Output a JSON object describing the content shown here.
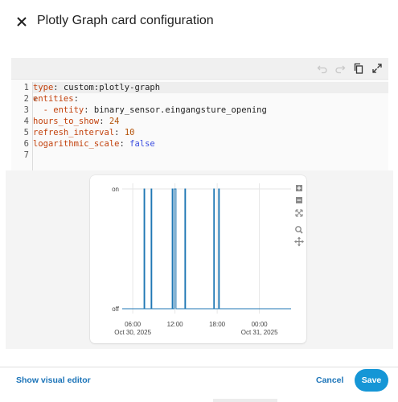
{
  "dialog": {
    "title": "Plotly Graph card configuration",
    "close_icon": "close-icon"
  },
  "toolbar": {
    "icons": [
      "undo-icon",
      "redo-icon",
      "copy-icon",
      "expand-icon"
    ]
  },
  "editor": {
    "line_numbers": [
      "1",
      "2",
      "3",
      "4",
      "5",
      "6",
      "7"
    ],
    "lines": [
      {
        "key": "type",
        "sep": ": ",
        "value": "custom:plotly-graph",
        "value_type": "string"
      },
      {
        "key": "entities",
        "sep": ":",
        "value": "",
        "value_type": "none"
      },
      {
        "key": "  - entity",
        "sep": ": ",
        "value": "binary_sensor.eingangsture_opening",
        "value_type": "string"
      },
      {
        "key": "hours_to_show",
        "sep": ": ",
        "value": "24",
        "value_type": "number"
      },
      {
        "key": "refresh_interval",
        "sep": ": ",
        "value": "10",
        "value_type": "number"
      },
      {
        "key": "logarithmic_scale",
        "sep": ": ",
        "value": "false",
        "value_type": "bool"
      },
      {
        "key": "",
        "sep": "",
        "value": "",
        "value_type": "none"
      }
    ],
    "fold_marker": "v",
    "colors": {
      "key": "#c2410c",
      "number": "#b45309",
      "bool": "#3b4de0"
    }
  },
  "plot": {
    "modebar_icons": [
      "zoom-in-box-icon",
      "zoom-out-box-icon",
      "autoscale-icon",
      "zoom-icon",
      "pan-icon"
    ]
  },
  "chart_data": {
    "type": "line",
    "title": "",
    "xlabel": "",
    "ylabel": "",
    "y_categories": [
      "off",
      "on"
    ],
    "x_tick_labels": [
      {
        "time": "06:00",
        "date": "Oct 30, 2025",
        "hours": 6
      },
      {
        "time": "12:00",
        "date": "",
        "hours": 12
      },
      {
        "time": "18:00",
        "date": "",
        "hours": 18
      },
      {
        "time": "00:00",
        "date": "Oct 31, 2025",
        "hours": 24
      }
    ],
    "xlim_hours": [
      4.5,
      28.5
    ],
    "series": [
      {
        "color": "#1f77b4",
        "on_intervals_hours": [
          [
            7.6,
            7.7
          ],
          [
            8.6,
            8.7
          ],
          [
            11.6,
            11.7
          ],
          [
            11.9,
            12.15
          ],
          [
            13.4,
            13.5
          ],
          [
            17.5,
            17.6
          ],
          [
            18.2,
            18.3
          ]
        ]
      }
    ],
    "grid": true
  },
  "footer": {
    "show_visual_editor": "Show visual editor",
    "cancel": "Cancel",
    "save": "Save"
  }
}
